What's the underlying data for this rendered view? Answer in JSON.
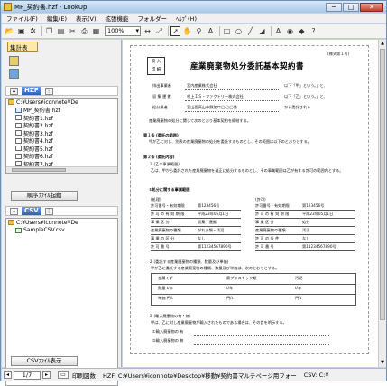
{
  "window": {
    "title": "MP_契約書.hzf - LookUp",
    "min": "─",
    "max": "□",
    "close": "✕"
  },
  "menu": [
    "ファイル(F)",
    "編集(E)",
    "表示(V)",
    "拡張機能",
    "フォルダー",
    "ﾍﾙﾌﾟ(H)"
  ],
  "toolbar": {
    "zoom": "100%"
  },
  "sidebar": {
    "tab_label": "集計表",
    "hzf_badge": "HZF",
    "hzf_tree": [
      {
        "label": "C:¥Users¥iconnote¥De",
        "kind": "folder",
        "indent": 0
      },
      {
        "label": "MP_契約書.hzf",
        "kind": "hzf",
        "indent": 1
      },
      {
        "label": "契約書1.hzf",
        "kind": "file",
        "indent": 1
      },
      {
        "label": "契約書2.hzf",
        "kind": "file",
        "indent": 1
      },
      {
        "label": "契約書3.hzf",
        "kind": "file",
        "indent": 1
      },
      {
        "label": "契約書4.hzf",
        "kind": "file",
        "indent": 1
      },
      {
        "label": "契約書5.hzf",
        "kind": "file",
        "indent": 1
      },
      {
        "label": "契約書6.hzf",
        "kind": "file",
        "indent": 1
      },
      {
        "label": "契約書7.hzf",
        "kind": "file",
        "indent": 1
      }
    ],
    "hzf_button": "順序ﾌｧｲﾙ起動",
    "csv_badge": "CSV",
    "csv_tree": [
      {
        "label": "C:¥Users¥iconnote¥De",
        "kind": "folder",
        "indent": 0
      },
      {
        "label": "SampleCSV.csv",
        "kind": "csv",
        "indent": 1
      }
    ],
    "csv_button": "CSVﾌｧｲﾙ表示"
  },
  "document": {
    "form_no": "(様式第１号)",
    "stamp": [
      "収 入",
      "印 紙"
    ],
    "title": "産業廃棄物処分委託基本契約書",
    "party_labels": [
      "排出事業者",
      "収 集 運 搬",
      "処分業者"
    ],
    "party_names": [
      "宮内産業株式会社",
      "村上ＩＳ・ファクトリー株式会社",
      "宮山西高山市野加口◯◯◯番"
    ],
    "party_suffix": [
      "以下「甲」という。」と、",
      "以下「乙」という。」と、",
      "から委託される"
    ],
    "intro": "産業廃棄物の処分に関して次のとおり基本契約を締結する。",
    "sec1_head": "第１条 (委託の範囲)",
    "sec1_text": "甲が乙に対し、別表の産業廃棄物の処分を委託するものとし、その範囲は以下のとおりとする。",
    "sec2_head": "第２条 (委託内容)",
    "sec2_sub": "１ (乙の事業範囲)",
    "sec2_text": "乙は、甲から委託された産業廃棄物を適正に処分するものとし、その事業範囲は乙が有する許可の範囲内とする。",
    "table_head": "①処分に関する事業範囲",
    "table_left_title": "(処理)",
    "table_right_title": "(許可)",
    "table_rows": [
      [
        "許可番号・有効期限",
        "第123456号",
        "許可番号・有効期限",
        "第123456号"
      ],
      [
        "許 可 の 有 効 期 限",
        "平成23年05月1日",
        "許 可 の 有 効 期 限",
        "平成23年05月1日"
      ],
      [
        "事 業 区 分",
        "収集・運搬",
        "事 業 区 分",
        "処分"
      ],
      [
        "産業廃棄物の種類",
        "がれき類・汚泥",
        "産業廃棄物の種類",
        "汚泥"
      ],
      [
        "事 業 の 区 分",
        "なし",
        "許 可 の 条 件",
        "なし"
      ],
      [
        "許 可 番 号",
        "第11234567890号",
        "許 可 番 号",
        "第11234567890号"
      ]
    ],
    "sec3_head": "２ (委託する産業廃棄物の種類、数量及び単価)",
    "sec3_text": "甲が乙に委託する産業廃棄物の種類、数量及び単価は、次のとおりとする。",
    "qty_header": [
      "種類",
      "数量",
      "単価"
    ],
    "qty_rows": [
      [
        "金属くず",
        "廃プラスチック類",
        "汚泥"
      ],
      [
        "数量 t/年",
        "t/年",
        "t/年"
      ],
      [
        "単価 円/t",
        "円/t",
        "円/t"
      ]
    ],
    "sec4_head": "３ (輸入廃棄物の有・無)",
    "sec4_text": "甲は、乙に対し産業廃棄物が輸入されたものである場合は、その旨を明示する。",
    "sec4_items": [
      "①輸入廃棄物の 有",
      "②輸入廃棄物の 無"
    ]
  },
  "status": {
    "page": "1/7",
    "print_label": "印刷図数",
    "hzf_path": "HZF: C:¥Users¥iconnote¥Desktop¥移動¥契約書マルチページ用フォー",
    "csv_path": "CSV: C:¥"
  }
}
